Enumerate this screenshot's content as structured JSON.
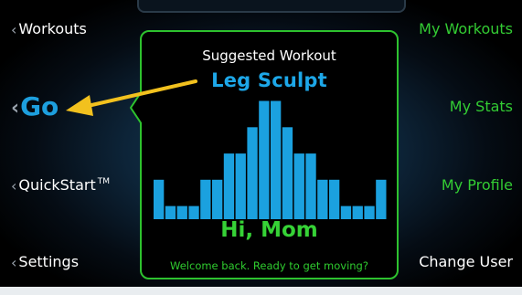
{
  "colors": {
    "accent_blue": "#1da7e8",
    "accent_green": "#33cc33",
    "card_border": "#2ec22e",
    "arrow_yellow": "#f2c11e"
  },
  "left_nav": {
    "chevron": "‹",
    "workouts": "Workouts",
    "go": "Go",
    "quickstart": "QuickStart",
    "quickstart_tm": "TM",
    "settings": "Settings"
  },
  "right_nav": {
    "my_workouts": "My Workouts",
    "my_stats": "My Stats",
    "my_profile": "My Profile",
    "change_user": "Change User"
  },
  "card": {
    "title": "Suggested Workout",
    "workout_name": "Leg Sculpt",
    "greeting": "Hi, Mom",
    "message": "Welcome back. Ready to get moving?"
  },
  "chart_data": {
    "type": "bar",
    "values": [
      3,
      1,
      1,
      1,
      3,
      3,
      5,
      5,
      7,
      9,
      9,
      7,
      5,
      5,
      3,
      3,
      1,
      1,
      1,
      3
    ],
    "color": "#1ba1df",
    "ylim": [
      0,
      9
    ]
  }
}
